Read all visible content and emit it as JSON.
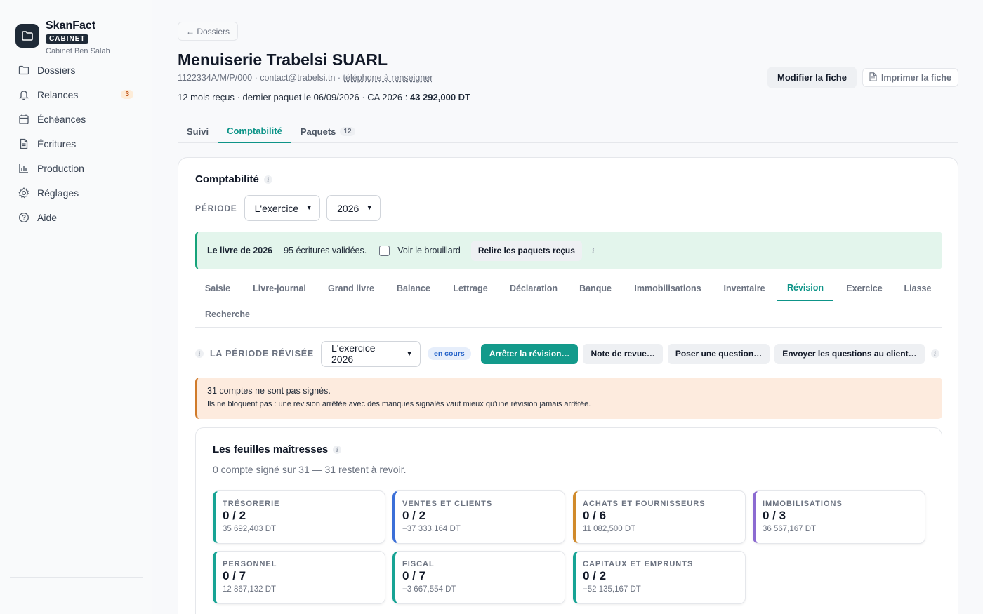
{
  "sidebar": {
    "brand": "SkanFact",
    "badge": "CABINET",
    "subtitle": "Cabinet Ben Salah",
    "items": [
      {
        "label": "Dossiers",
        "icon": "folder-icon"
      },
      {
        "label": "Relances",
        "icon": "bell-icon",
        "badge": "3"
      },
      {
        "label": "Échéances",
        "icon": "calendar-icon"
      },
      {
        "label": "Écritures",
        "icon": "document-icon"
      },
      {
        "label": "Production",
        "icon": "bar-chart-icon"
      },
      {
        "label": "Réglages",
        "icon": "gear-icon"
      },
      {
        "label": "Aide",
        "icon": "help-circle-icon"
      }
    ]
  },
  "header": {
    "back": "← Dossiers",
    "title": "Menuiserie Trabelsi SUARL",
    "meta_id": "1122334A/M/P/000",
    "meta_sep": " · ",
    "meta_email": "contact@trabelsi.tn",
    "meta_phone": "téléphone à renseigner",
    "summary_text": "12 mois reçus · dernier paquet le 06/09/2026 · CA 2026 : ",
    "summary_ca": "43 292,000 DT",
    "edit_button": "Modifier la fiche",
    "print_button": "Imprimer la fiche"
  },
  "tabs": [
    {
      "label": "Suivi"
    },
    {
      "label": "Comptabilité",
      "active": true
    },
    {
      "label": "Paquets",
      "count": "12"
    }
  ],
  "compta": {
    "title": "Comptabilité",
    "period_label": "PÉRIODE",
    "period_value": "L'exercice",
    "year_value": "2026",
    "banner_bold": "Le livre de 2026",
    "banner_text": " — 95 écritures validées.",
    "banner_checkbox": "Voir le brouillard",
    "banner_button": "Relire les paquets reçus",
    "subtabs": [
      "Saisie",
      "Livre-journal",
      "Grand livre",
      "Balance",
      "Lettrage",
      "Déclaration",
      "Banque",
      "Immobilisations",
      "Inventaire",
      "Révision",
      "Exercice",
      "Liasse",
      "Recherche"
    ],
    "active_subtab": "Révision"
  },
  "revision": {
    "period_label": "LA PÉRIODE RÉVISÉE",
    "period_value": "L'exercice 2026",
    "status": "en cours",
    "btn_stop": "Arrêter la révision…",
    "btn_note": "Note de revue…",
    "btn_question": "Poser une question…",
    "btn_send": "Envoyer les questions au client…",
    "warning_line1": "31 comptes ne sont pas signés.",
    "warning_line2": "Ils ne bloquent pas : une révision arrêtée avec des manques signalés vaut mieux qu'une révision jamais arrêtée."
  },
  "feuilles": {
    "title": "Les feuilles maîtresses",
    "subtitle": "0 compte signé sur 31 — 31 restent à revoir.",
    "cards": [
      {
        "name": "TRÉSORERIE",
        "count": "0 / 2",
        "amount": "35 692,403 DT",
        "color": "#16a394"
      },
      {
        "name": "VENTES ET CLIENTS",
        "count": "0 / 2",
        "amount": "−37 333,164 DT",
        "color": "#3b6fd8"
      },
      {
        "name": "ACHATS ET FOURNISSEURS",
        "count": "0 / 6",
        "amount": "11 082,500 DT",
        "color": "#d08a2b"
      },
      {
        "name": "IMMOBILISATIONS",
        "count": "0 / 3",
        "amount": "36 567,167 DT",
        "color": "#8b6ad1"
      },
      {
        "name": "PERSONNEL",
        "count": "0 / 7",
        "amount": "12 867,132 DT",
        "color": "#16a394"
      },
      {
        "name": "FISCAL",
        "count": "0 / 7",
        "amount": "−3 667,554 DT",
        "color": "#16a394"
      },
      {
        "name": "CAPITAUX ET EMPRUNTS",
        "count": "0 / 2",
        "amount": "−52 135,167 DT",
        "color": "#16a394"
      }
    ]
  }
}
